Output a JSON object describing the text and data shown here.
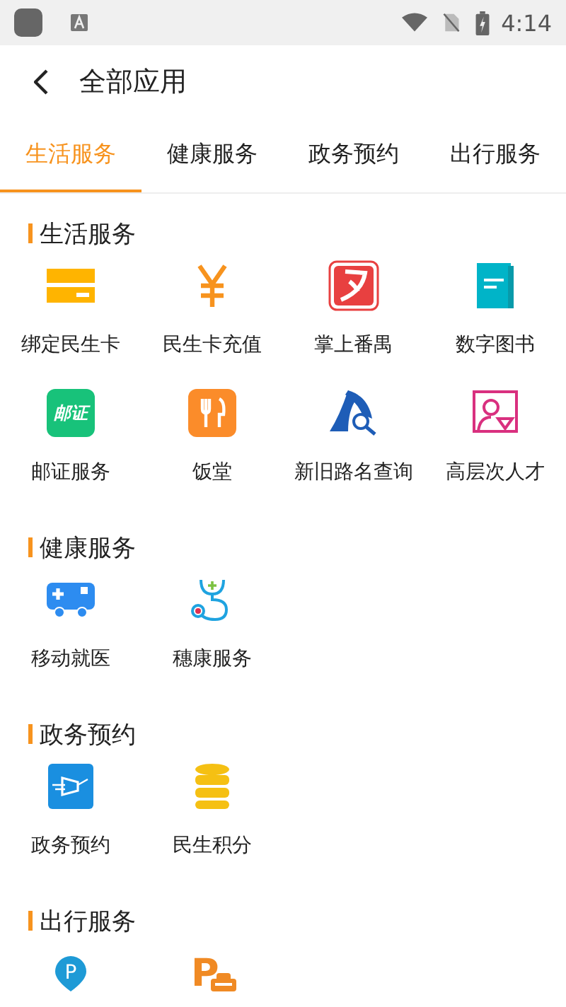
{
  "status_bar": {
    "time": "4:14"
  },
  "header": {
    "title": "全部应用"
  },
  "tabs": [
    {
      "label": "生活服务",
      "selected": true
    },
    {
      "label": "健康服务",
      "selected": false
    },
    {
      "label": "政务预约",
      "selected": false
    },
    {
      "label": "出行服务",
      "selected": false
    }
  ],
  "sections": [
    {
      "title": "生活服务",
      "items": [
        {
          "label": "绑定民生卡",
          "kind": "card"
        },
        {
          "label": "民生卡充值",
          "kind": "yen"
        },
        {
          "label": "掌上番禺",
          "kind": "red-app"
        },
        {
          "label": "数字图书",
          "kind": "book"
        },
        {
          "label": "邮证服务",
          "kind": "post",
          "icon_text": "邮证"
        },
        {
          "label": "饭堂",
          "kind": "food"
        },
        {
          "label": "新旧路名查询",
          "kind": "road"
        },
        {
          "label": "高层次人才",
          "kind": "person"
        }
      ]
    },
    {
      "title": "健康服务",
      "items": [
        {
          "label": "移动就医",
          "kind": "ambulance"
        },
        {
          "label": "穗康服务",
          "kind": "stethoscope"
        }
      ]
    },
    {
      "title": "政务预约",
      "items": [
        {
          "label": "政务预约",
          "kind": "gov"
        },
        {
          "label": "民生积分",
          "kind": "coins"
        }
      ]
    },
    {
      "title": "出行服务",
      "items": [
        {
          "kind": "parking-pin",
          "icon_text": "P"
        },
        {
          "kind": "parking-car",
          "icon_text": "P"
        }
      ]
    }
  ]
}
